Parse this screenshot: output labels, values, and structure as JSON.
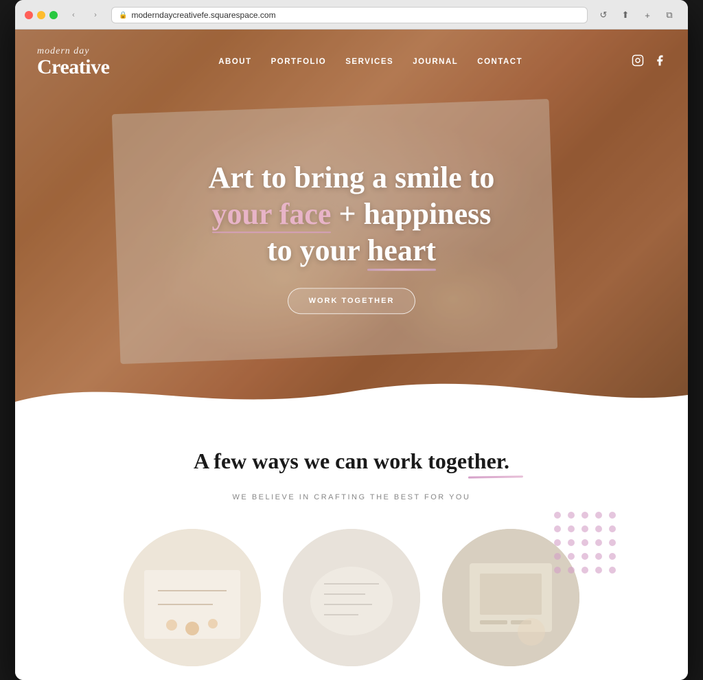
{
  "browser": {
    "url": "moderndaycreativefe.squarespace.com",
    "refresh_label": "↺",
    "back_label": "‹",
    "forward_label": "›",
    "share_label": "⬆",
    "add_tab_label": "+",
    "tabs_label": "⧉"
  },
  "nav": {
    "logo_script": "modern day",
    "logo_main": "Creative",
    "links": [
      {
        "label": "ABOUT",
        "id": "about"
      },
      {
        "label": "PORTFOLIO",
        "id": "portfolio"
      },
      {
        "label": "SERVICES",
        "id": "services"
      },
      {
        "label": "JOURNAL",
        "id": "journal"
      },
      {
        "label": "CONTACT",
        "id": "contact"
      }
    ],
    "social": [
      {
        "label": "○",
        "id": "instagram"
      },
      {
        "label": "f",
        "id": "facebook"
      }
    ]
  },
  "hero": {
    "headline_part1": "Art to bring a smile to",
    "headline_part2": "your face",
    "headline_connector": " + happiness",
    "headline_part3": "to your ",
    "headline_heart": "heart",
    "cta_label": "WORK TOGETHER"
  },
  "section": {
    "title": "A few ways we can work together.",
    "subtitle": "WE BELIEVE IN CRAFTING THE BEST FOR YOU"
  }
}
